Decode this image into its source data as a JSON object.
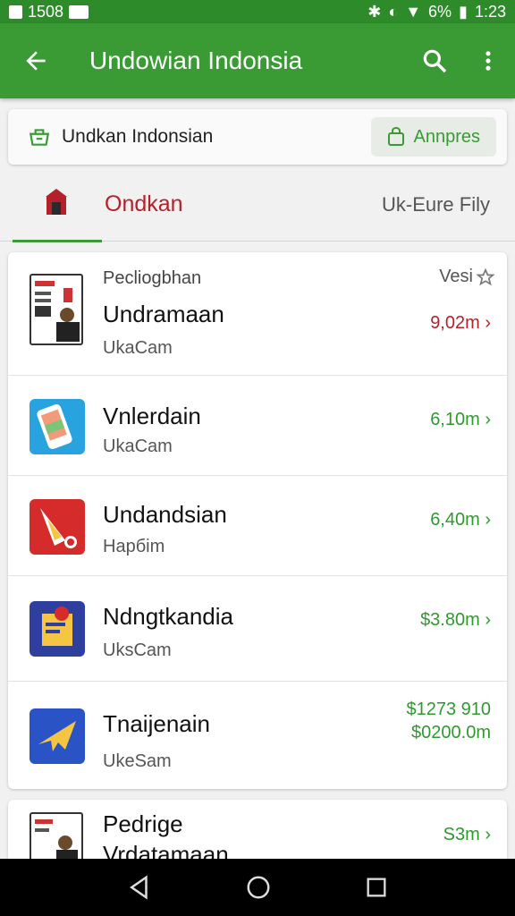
{
  "status_bar": {
    "time_left": "1508",
    "battery": "6%",
    "clock": "1:23"
  },
  "app_bar": {
    "title": "Undowian Indonsia"
  },
  "search_card": {
    "label": "Undkan Indonsian",
    "button_label": "Annpres"
  },
  "tabs": {
    "active_label": "Ondkan",
    "right_label": "Uk-Eure Fily"
  },
  "list": {
    "header": {
      "overline": "Pecliogbhan",
      "ver": "Vesi"
    },
    "items": [
      {
        "name": "Undramaan",
        "sub": "UkaCam",
        "value": "9,02m",
        "value_color": "#b4212a"
      },
      {
        "name": "Vnlerdain",
        "sub": "UkaCam",
        "value": "6,10m"
      },
      {
        "name": "Undandsian",
        "sub": "Hapбim",
        "value": "6,40m"
      },
      {
        "name": "Ndngtkandia",
        "sub": "UksCam",
        "value": "$3.80m"
      },
      {
        "name": "Tnaijenain",
        "sub": "UkeSam",
        "value_line1": "$1273 910",
        "value_line2": "$0200.0m"
      }
    ],
    "peek": {
      "name_line1": "Pedrige",
      "name_line2": "Vrdatamaan",
      "value": "S3m"
    }
  },
  "colors": {
    "primary": "#3a9b34",
    "accent_red": "#b4212a",
    "value_green": "#2e9a2e"
  }
}
